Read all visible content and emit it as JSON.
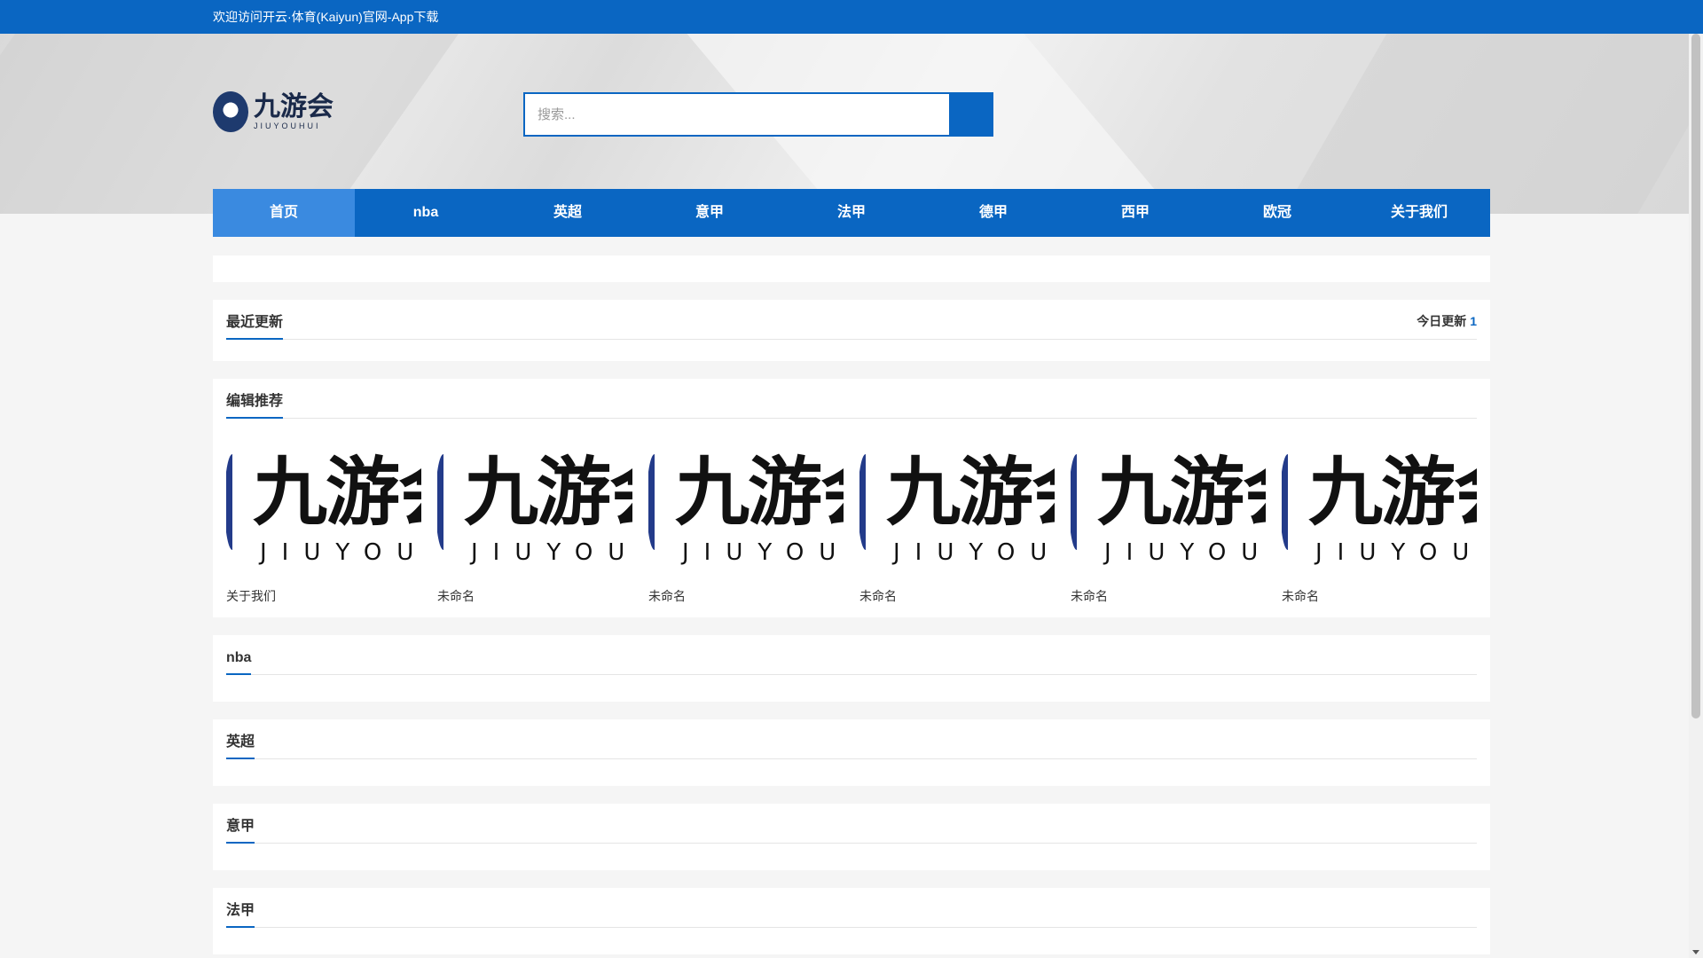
{
  "topbar": {
    "welcome": "欢迎访问开云·体育(Kaiyun)官网-App下载"
  },
  "logo": {
    "cn": "九游会",
    "en": "JIUYOUHUI"
  },
  "search": {
    "placeholder": "搜索..."
  },
  "nav": {
    "items": [
      {
        "label": "首页",
        "active": true
      },
      {
        "label": "nba"
      },
      {
        "label": "英超"
      },
      {
        "label": "意甲"
      },
      {
        "label": "法甲"
      },
      {
        "label": "德甲"
      },
      {
        "label": "西甲"
      },
      {
        "label": "欧冠"
      },
      {
        "label": "关于我们"
      }
    ]
  },
  "recent": {
    "title": "最近更新",
    "today_label": "今日更新",
    "today_count": "1"
  },
  "editor": {
    "title": "编辑推荐",
    "thumb_cn": "九游会",
    "thumb_en": "JIUYOUHUI",
    "cards": [
      {
        "title": "关于我们"
      },
      {
        "title": "未命名"
      },
      {
        "title": "未命名"
      },
      {
        "title": "未命名"
      },
      {
        "title": "未命名"
      },
      {
        "title": "未命名"
      }
    ]
  },
  "sections": [
    {
      "title": "nba"
    },
    {
      "title": "英超"
    },
    {
      "title": "意甲"
    },
    {
      "title": "法甲"
    }
  ],
  "colors": {
    "primary": "#0a66c2",
    "nav_active": "#3a8ae0"
  }
}
